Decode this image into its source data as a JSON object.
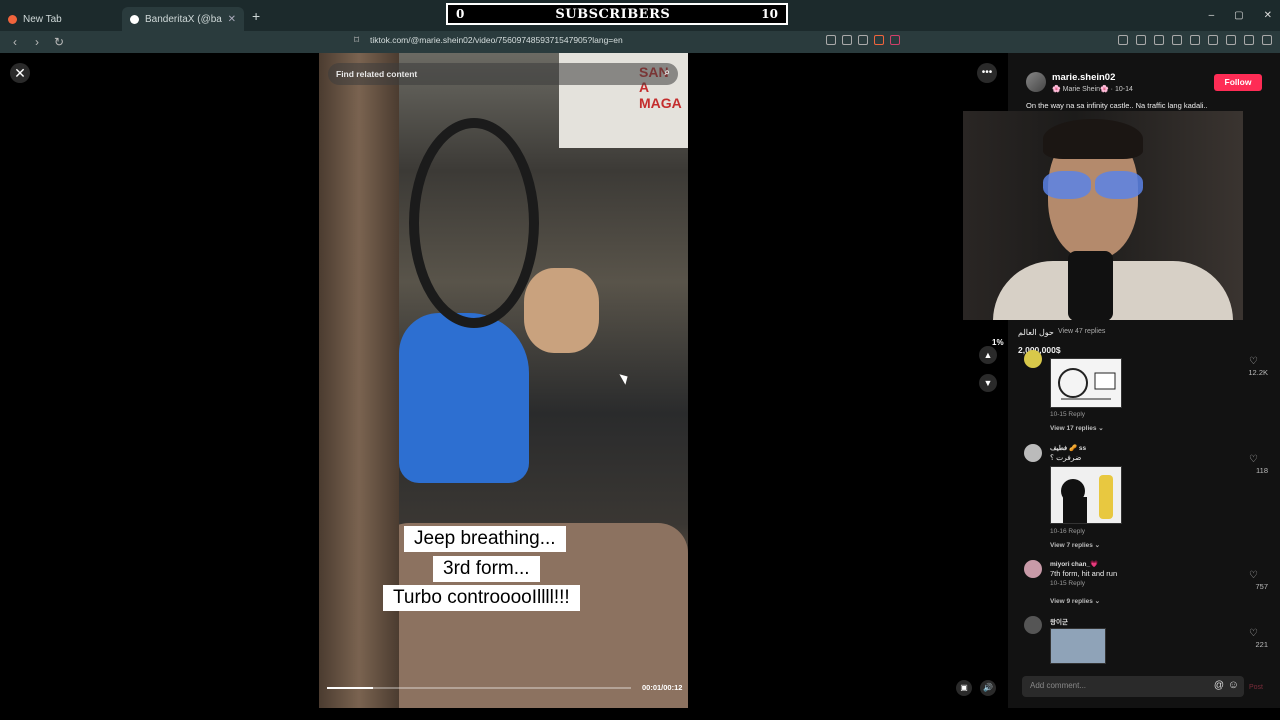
{
  "browser": {
    "tabs": [
      {
        "label": "New Tab",
        "active": false
      },
      {
        "label": "BanderitaX (@banderitax) Of",
        "active": true
      }
    ],
    "new_tab": "+",
    "url": "tiktok.com/@marie.shein02/video/7560974859371547905?lang=en",
    "window_controls": [
      "–",
      "▢",
      "✕"
    ]
  },
  "overlay": {
    "left_count": "0",
    "title": "SUBSCRIBERS",
    "right_count": "10"
  },
  "video": {
    "find_related_placeholder": "Find related content",
    "captions": [
      "Jeep breathing...",
      "3rd form...",
      "Turbo controoooIllll!!!"
    ],
    "sign_text": "SAN\nA\nMAGA",
    "timecode": "00:01/00:12",
    "progress": 0.15
  },
  "controls": {
    "close": "✕",
    "more": "•••",
    "up": "▲",
    "down": "▼",
    "percent": "1%"
  },
  "post": {
    "username": "marie.shein02",
    "display": "🌸 Marie Shein🌸 · 10-14",
    "follow": "Follow",
    "description": "On the way na sa infinity castle.. Na traffic lang kadali.."
  },
  "comments_partial": {
    "line1": "حول العالم",
    "line2": "2,000,000$",
    "view_replies": "View 47 replies"
  },
  "comments": [
    {
      "name": "",
      "text": "",
      "meta": "10-15   Reply",
      "replies": "View 17 replies ⌄",
      "likes": "12.2K"
    },
    {
      "name": "فطيف 🥜 ss",
      "text": "ضرفرت ؟",
      "meta": "10-16   Reply",
      "replies": "View 7 replies ⌄",
      "likes": "118"
    },
    {
      "name": "miyori chan_💗",
      "text": "7th form, hit and run",
      "meta": "10-15   Reply",
      "replies": "View 9 replies ⌄",
      "likes": "757"
    },
    {
      "name": "왕이군",
      "text": "",
      "meta": "",
      "replies": "",
      "likes": "221"
    }
  ],
  "input": {
    "placeholder": "Add comment...",
    "post": "Post"
  }
}
